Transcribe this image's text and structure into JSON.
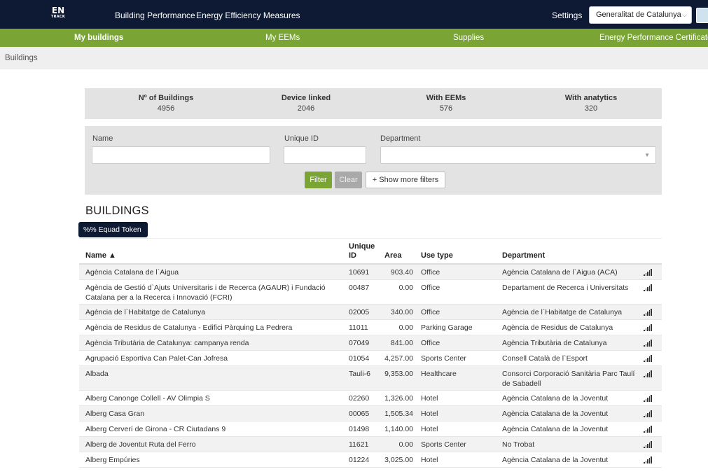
{
  "header": {
    "logo_text": "EN",
    "logo_sub": "TRACK",
    "nav": [
      {
        "label": "Building Performance"
      },
      {
        "label": "Energy Efficiency Measures"
      }
    ],
    "settings_label": "Settings",
    "org_select_value": "Generalitat de Catalunya",
    "org_select_icon": "chevron-down-icon"
  },
  "subnav": [
    {
      "label": "My buildings",
      "active": true
    },
    {
      "label": "My EEMs"
    },
    {
      "label": "Supplies"
    },
    {
      "label": "Energy Performance Certificate"
    }
  ],
  "breadcrumb": "Buildings",
  "stats": [
    {
      "label": "Nº of Buildings",
      "value": "4956"
    },
    {
      "label": "Device linked",
      "value": "2046"
    },
    {
      "label": "With EEMs",
      "value": "576"
    },
    {
      "label": "With anatytics",
      "value": "320"
    }
  ],
  "filters": {
    "name_label": "Name",
    "name_value": "",
    "unique_id_label": "Unique ID",
    "unique_id_value": "",
    "department_label": "Department",
    "department_value": "",
    "filter_button": "Filter",
    "clear_button": "Clear",
    "more_filters_button": "+  Show more filters"
  },
  "section_title": "BUILDINGS",
  "token_button": "%% Equad Token",
  "table": {
    "columns": [
      "Name ▲",
      "Unique ID",
      "Area",
      "Use type",
      "Department"
    ],
    "rows": [
      {
        "name": "Agència Catalana de l`Aigua",
        "id": "10691",
        "area": "903.40",
        "use": "Office",
        "dept": "Agència Catalana de l`Aigua (ACA)"
      },
      {
        "name": "Agència de Gestió d`Ajuts Universitaris i de Recerca (AGAUR) i Fundació Catalana per a la Recerca i Innovació (FCRI)",
        "id": "00487",
        "area": "0.00",
        "use": "Office",
        "dept": "Departament de Recerca i Universitats"
      },
      {
        "name": "Agència de l`Habitatge de Catalunya",
        "id": "02005",
        "area": "340.00",
        "use": "Office",
        "dept": "Agència de l`Habitatge de Catalunya"
      },
      {
        "name": "Agència de Residus de Catalunya - Edifici Pàrquing La Pedrera",
        "id": "11011",
        "area": "0.00",
        "use": "Parking Garage",
        "dept": "Agència de Residus de Catalunya"
      },
      {
        "name": "Agència Tributària de Catalunya: campanya renda",
        "id": "07049",
        "area": "841.00",
        "use": "Office",
        "dept": "Agència Tributària de Catalunya"
      },
      {
        "name": "Agrupació Esportiva Can Palet-Can Jofresa",
        "id": "01054",
        "area": "4,257.00",
        "use": "Sports Center",
        "dept": "Consell Català de l`Esport"
      },
      {
        "name": "Albada",
        "id": "Tauli-6",
        "area": "9,353.00",
        "use": "Healthcare",
        "dept": "Consorci Corporació Sanitària Parc Taulí de Sabadell"
      },
      {
        "name": "Alberg Canonge Collell - AV Olimpia S",
        "id": "02260",
        "area": "1,326.00",
        "use": "Hotel",
        "dept": "Agència Catalana de la Joventut"
      },
      {
        "name": "Alberg Casa Gran",
        "id": "00065",
        "area": "1,505.34",
        "use": "Hotel",
        "dept": "Agència Catalana de la Joventut"
      },
      {
        "name": "Alberg Cerverí de Girona - CR Ciutadans 9",
        "id": "01498",
        "area": "1,140.00",
        "use": "Hotel",
        "dept": "Agència Catalana de la Joventut"
      },
      {
        "name": "Alberg de Joventut Ruta del Ferro",
        "id": "11621",
        "area": "0.00",
        "use": "Sports Center",
        "dept": "No Trobat"
      },
      {
        "name": "Alberg Empúries",
        "id": "01224",
        "area": "3,025.00",
        "use": "Hotel",
        "dept": "Agència Catalana de la Joventut"
      }
    ],
    "row_action_icon": "signal-bars-icon"
  }
}
